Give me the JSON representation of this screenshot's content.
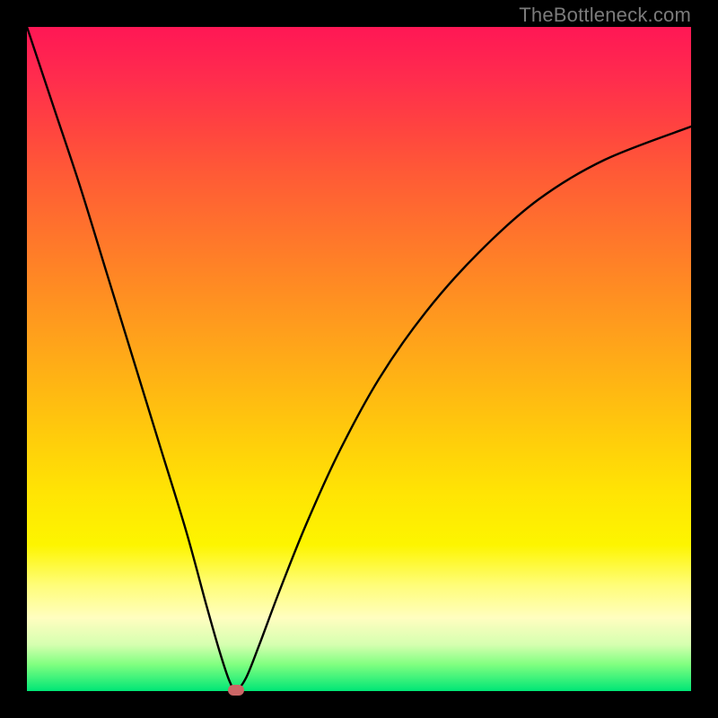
{
  "watermark": "TheBottleneck.com",
  "colors": {
    "curve_stroke": "#000000",
    "marker_fill": "#cc6666",
    "frame_bg": "#000000"
  },
  "chart_data": {
    "type": "line",
    "title": "",
    "xlabel": "",
    "ylabel": "",
    "xlim": [
      0,
      100
    ],
    "ylim": [
      0,
      100
    ],
    "grid": false,
    "legend": null,
    "series": [
      {
        "name": "bottleneck-curve",
        "x": [
          0,
          4,
          8,
          12,
          16,
          20,
          24,
          27,
          29,
          30.5,
          31.5,
          33,
          35,
          38,
          42,
          47,
          53,
          60,
          68,
          77,
          87,
          100
        ],
        "y": [
          100,
          88,
          76,
          63,
          50,
          37,
          24,
          13,
          6,
          1.5,
          0.2,
          2,
          7,
          15,
          25,
          36,
          47,
          57,
          66,
          74,
          80,
          85
        ]
      }
    ],
    "annotations": [
      {
        "name": "optimal-point",
        "x": 31.5,
        "y": 0.2
      }
    ],
    "gradient_stops": [
      {
        "p": 0,
        "c": "#ff1755"
      },
      {
        "p": 50,
        "c": "#ffaa10"
      },
      {
        "p": 78,
        "c": "#fdf500"
      },
      {
        "p": 100,
        "c": "#00e676"
      }
    ]
  }
}
